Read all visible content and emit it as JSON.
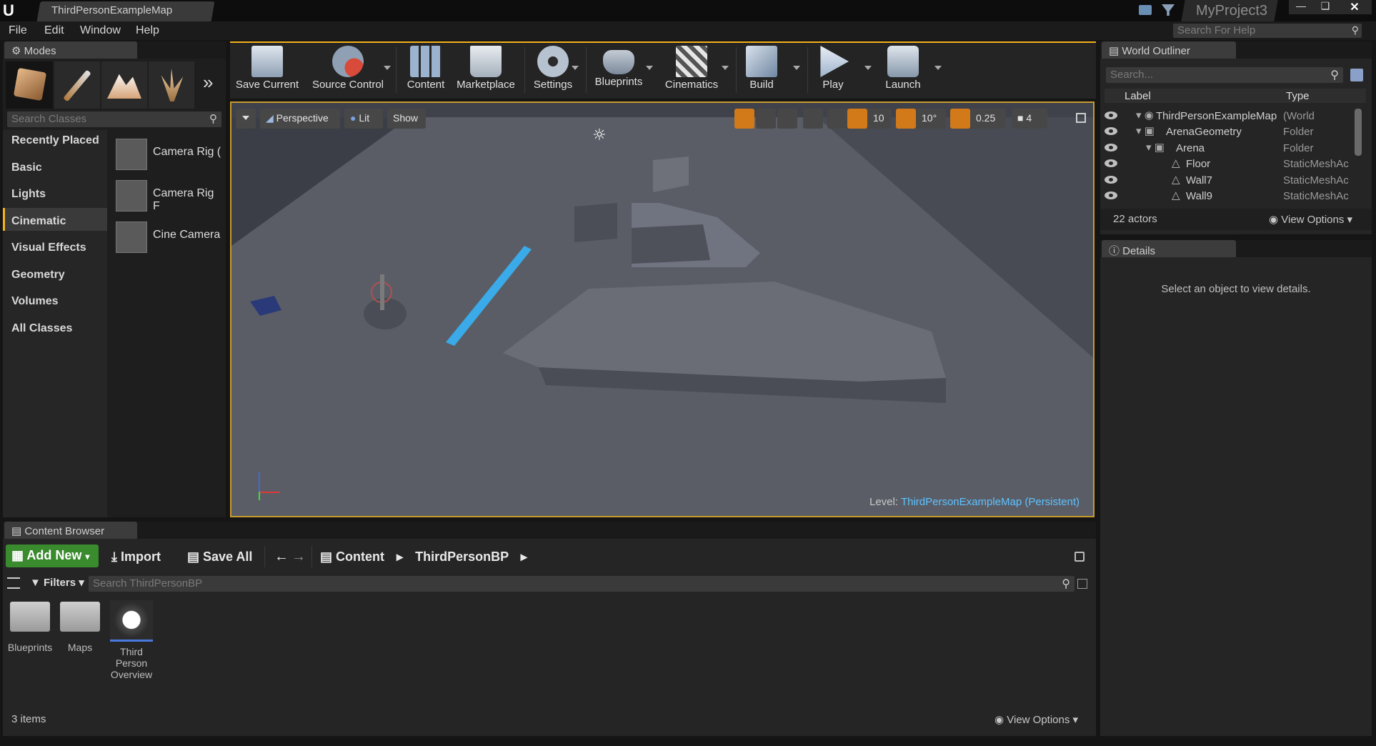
{
  "window": {
    "tab_title": "ThirdPersonExampleMap",
    "project_name": "MyProject3",
    "help_search_placeholder": "Search For Help"
  },
  "menu": [
    "File",
    "Edit",
    "Window",
    "Help"
  ],
  "modes": {
    "tab_label": "Modes",
    "search_placeholder": "Search Classes",
    "categories": [
      "Recently Placed",
      "Basic",
      "Lights",
      "Cinematic",
      "Visual Effects",
      "Geometry",
      "Volumes",
      "All Classes"
    ],
    "selected_category": "Cinematic",
    "items": [
      "Camera Rig (",
      "Camera Rig F",
      "Cine Camera"
    ]
  },
  "toolbar": [
    "Save Current",
    "Source Control",
    "Content",
    "Marketplace",
    "Settings",
    "Blueprints",
    "Cinematics",
    "Build",
    "Play",
    "Launch"
  ],
  "viewport": {
    "perspective": "Perspective",
    "lit": "Lit",
    "show": "Show",
    "grid_snap": "10",
    "rotation_snap": "10°",
    "scale_snap": "0.25",
    "camera_speed": "4",
    "level_label": "Level:",
    "level_name": "ThirdPersonExampleMap (Persistent)"
  },
  "outliner": {
    "tab_label": "World Outliner",
    "search_placeholder": "Search...",
    "col_label": "Label",
    "col_type": "Type",
    "rows": [
      {
        "label": "ThirdPersonExampleMap",
        "type": "(World"
      },
      {
        "label": "ArenaGeometry",
        "type": "Folder"
      },
      {
        "label": "Arena",
        "type": "Folder"
      },
      {
        "label": "Floor",
        "type": "StaticMeshAc"
      },
      {
        "label": "Wall7",
        "type": "StaticMeshAc"
      },
      {
        "label": "Wall9",
        "type": "StaticMeshAc"
      }
    ],
    "actor_count": "22 actors",
    "view_options": "View Options"
  },
  "details": {
    "tab_label": "Details",
    "empty_text": "Select an object to view details."
  },
  "content_browser": {
    "tab_label": "Content Browser",
    "add_new": "Add New",
    "import": "Import",
    "save_all": "Save All",
    "path": [
      "Content",
      "ThirdPersonBP"
    ],
    "filters": "Filters",
    "search_placeholder": "Search ThirdPersonBP",
    "assets": [
      "Blueprints",
      "Maps",
      "Third Person Overview"
    ],
    "item_count": "3 items",
    "view_options": "View Options"
  },
  "colors": {
    "accent": "#f5b21a",
    "viewport_bg": "#4a4d55",
    "link": "#5ec2ff",
    "green_button": "#3a8a2e"
  }
}
